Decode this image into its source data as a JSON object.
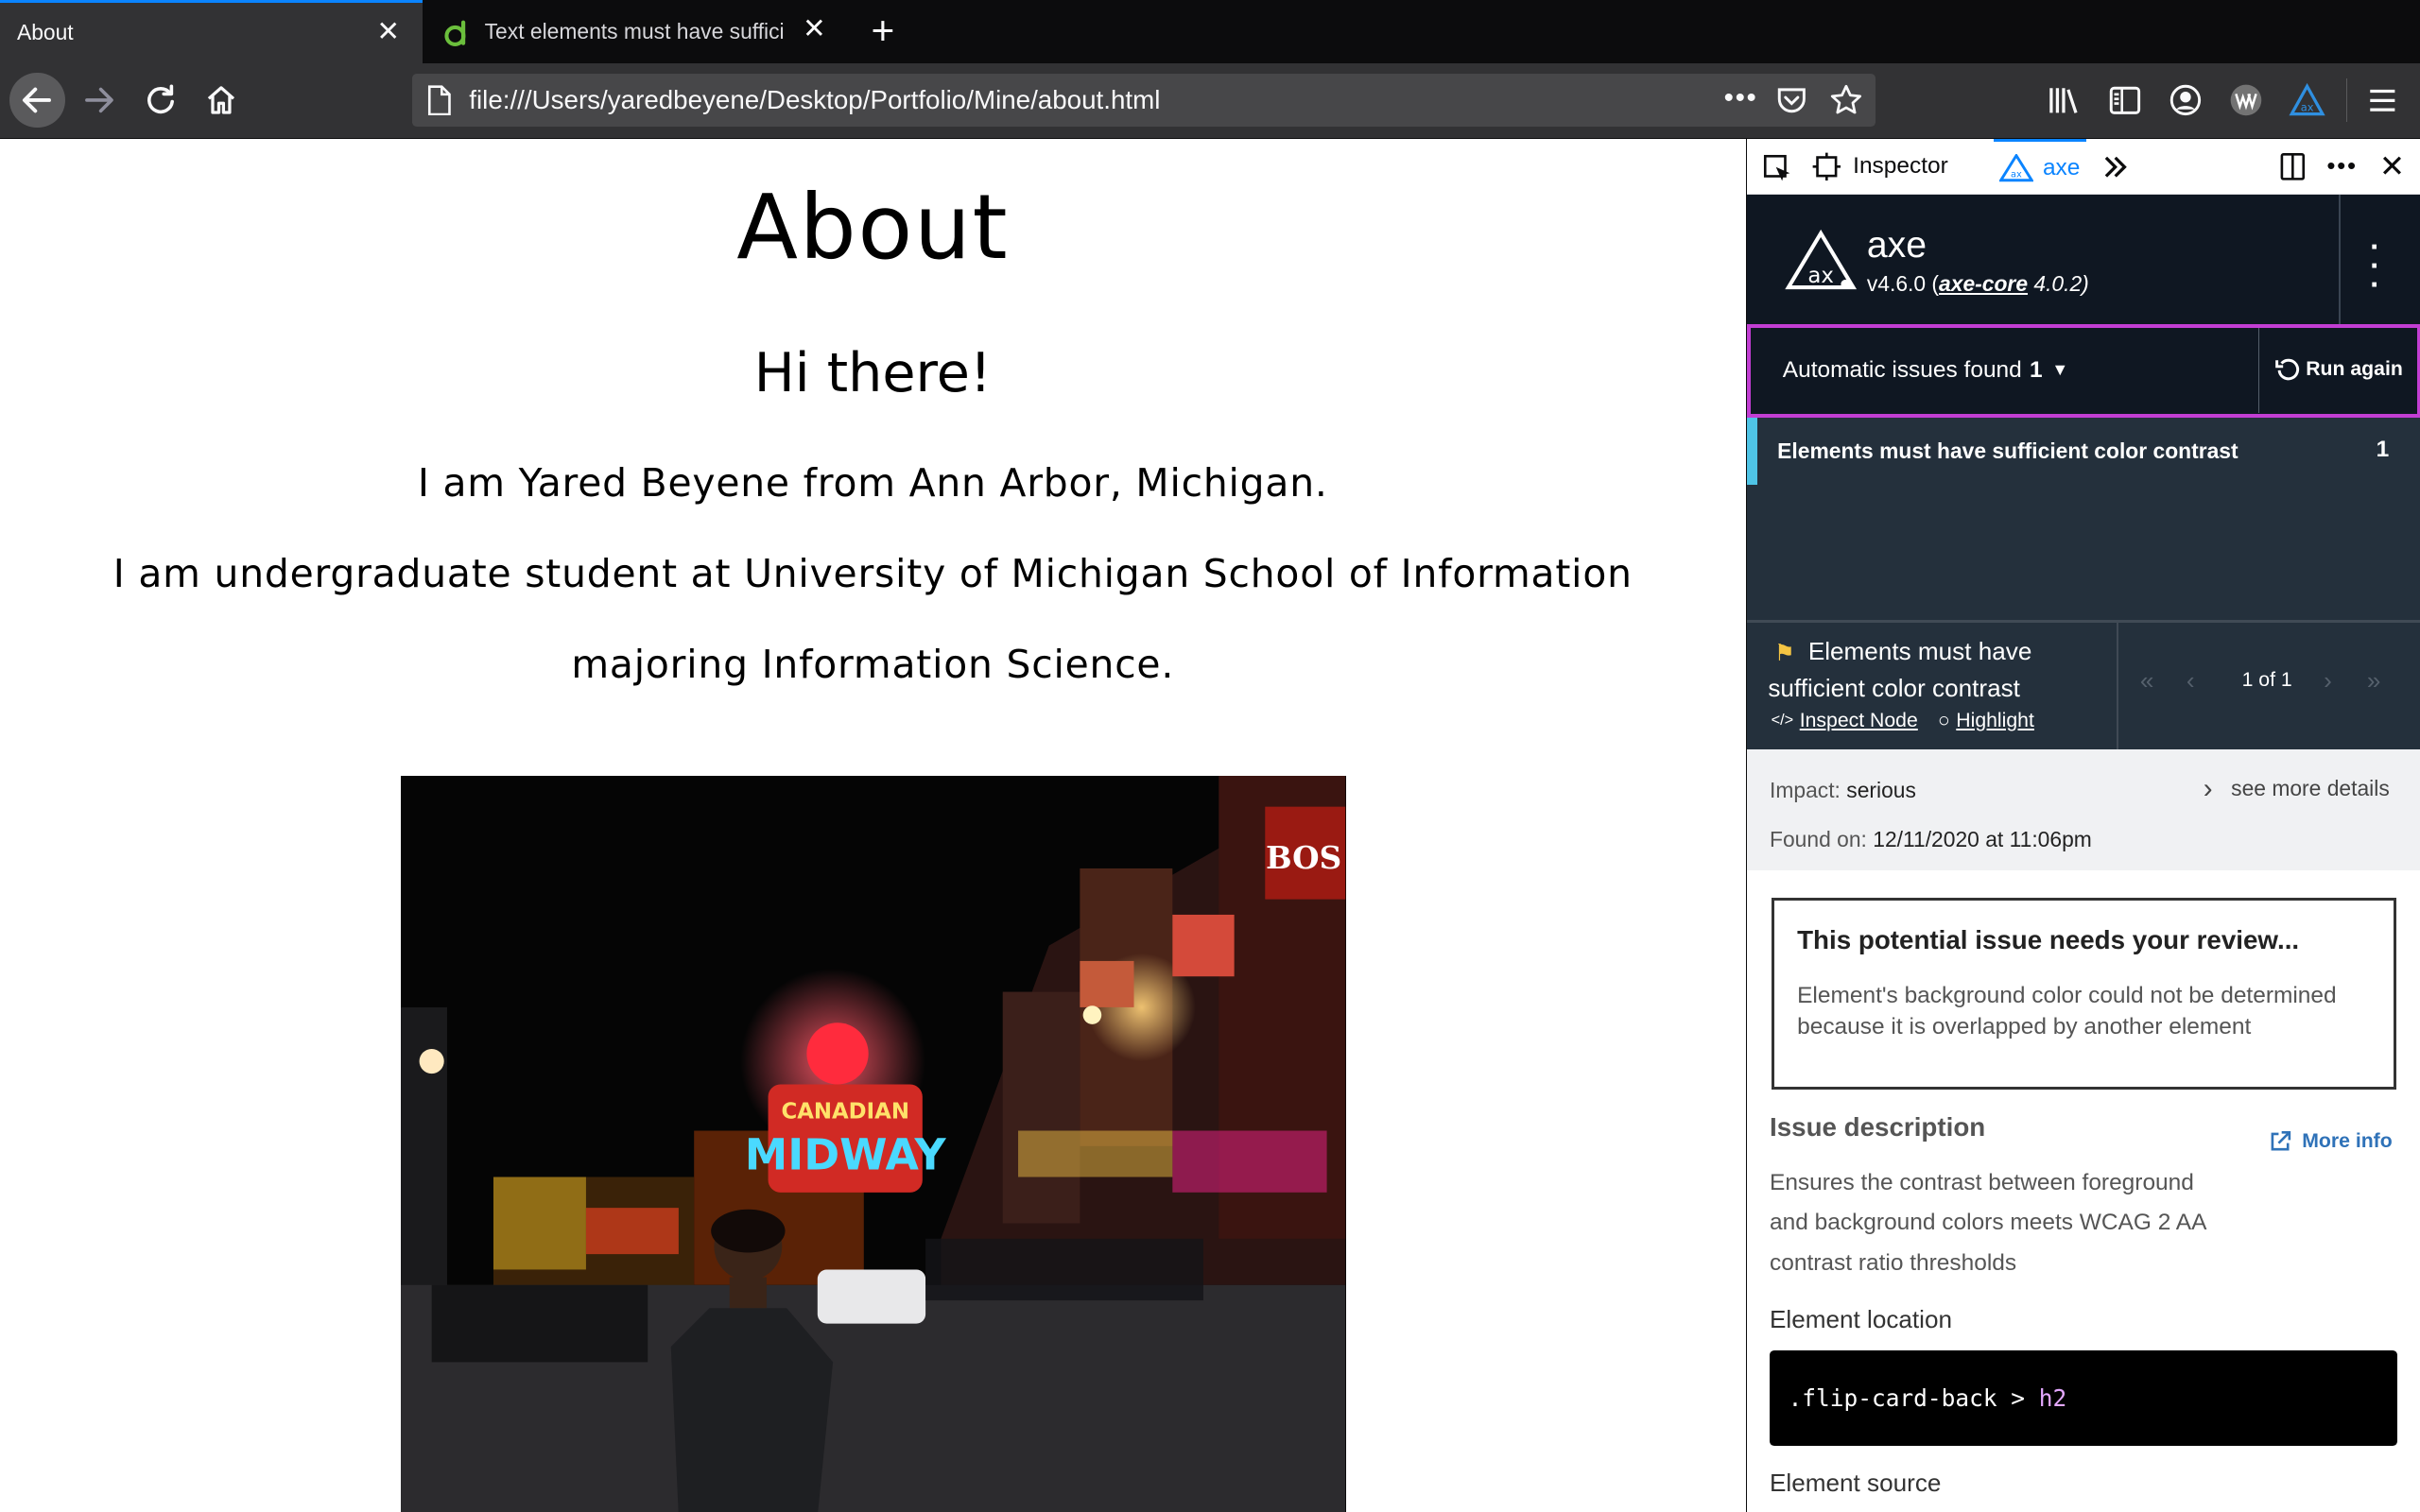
{
  "browser": {
    "tabs": [
      {
        "title": "About"
      },
      {
        "title": "Text elements must have suffici"
      }
    ],
    "url": "file:///Users/yaredbeyene/Desktop/Portfolio/Mine/about.html"
  },
  "page": {
    "title": "About",
    "greeting": "Hi there!",
    "line1": "I am Yared Beyene from Ann Arbor, Michigan.",
    "line2": "I am undergraduate student at University of Michigan School of Information",
    "line3": "majoring Information Science."
  },
  "devtools": {
    "tabs": {
      "inspector": "Inspector",
      "axe": "axe"
    },
    "axe": {
      "name": "axe",
      "version": "v4.6.0 (",
      "core_link": "axe-core",
      "core_version": " 4.0.2)",
      "issues_label": "Automatic issues found",
      "issues_count": "1",
      "run_again": "Run again",
      "rule_title": "Elements must have sufficient color contrast",
      "rule_count": "1",
      "detail_title_1": "Elements must have",
      "detail_title_2": "sufficient color contrast",
      "inspect_node": "Inspect Node",
      "highlight": "Highlight",
      "pager": "1 of 1",
      "impact_label": "Impact:",
      "impact_value": "serious",
      "see_more": "see more details",
      "found_label": "Found on:",
      "found_value": "12/11/2020 at 11:06pm",
      "review_title": "This potential issue needs your review...",
      "review_body": "Element's background color could not be determined because it is overlapped by another element",
      "issue_desc_heading": "Issue description",
      "more_info": "More info",
      "issue_desc": "Ensures the contrast between foreground and background colors meets WCAG 2 AA contrast ratio thresholds",
      "element_location_heading": "Element location",
      "selector_part1": ".flip-card-back",
      "selector_sep": " > ",
      "selector_part2": "h2",
      "element_source_heading": "Element source"
    }
  },
  "colors": {
    "accent": "#0a84ff",
    "axe_highlight": "#c23ed3",
    "rule_bar": "#4fc4e6"
  }
}
